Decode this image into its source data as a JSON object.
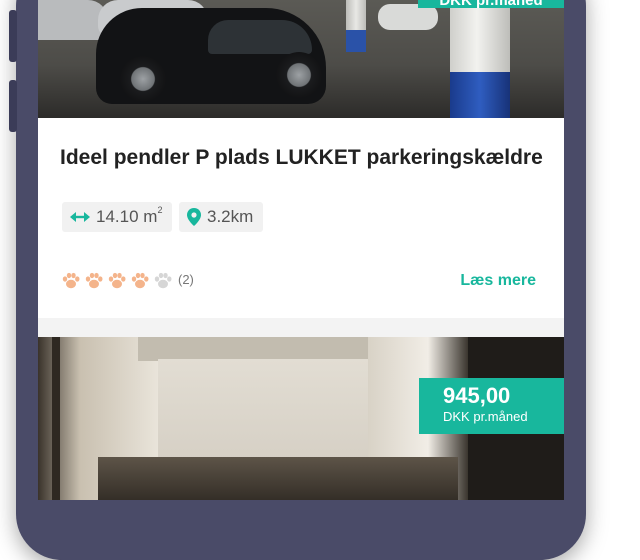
{
  "listings": [
    {
      "price_amount": "",
      "price_unit": "DKK pr.måned",
      "title": "Ideel pendler P plads LUKKET parkeringskældre",
      "size_value": "14.10 m",
      "size_unit_sup": "2",
      "distance": "3.2km",
      "rating_filled": 4,
      "rating_total": 5,
      "rating_count": "(2)",
      "read_more_label": "Læs mere"
    },
    {
      "price_amount": "945,00",
      "price_unit": "DKK pr.måned"
    }
  ],
  "colors": {
    "accent": "#18b79d",
    "paw_filled": "#f4b48b",
    "paw_empty": "#d6d6d6",
    "icon_teal": "#18b79d"
  },
  "icons": {
    "size": "double-arrow-icon",
    "distance": "map-pin-icon",
    "rating": "paw-icon"
  }
}
